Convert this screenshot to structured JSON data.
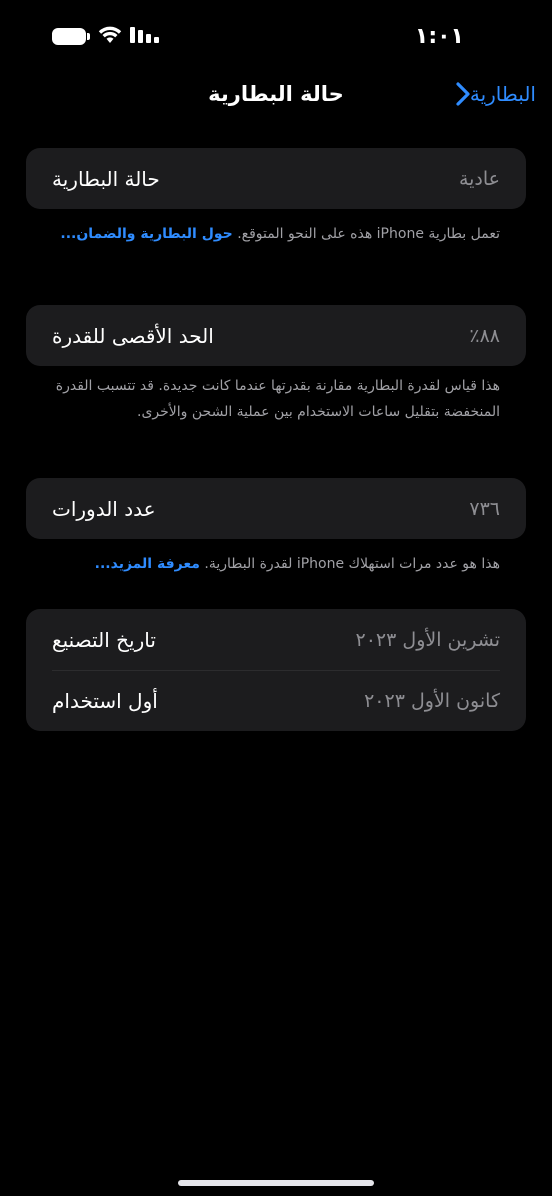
{
  "status_bar": {
    "time": "١:٠١"
  },
  "nav": {
    "back_label": "البطارية",
    "title": "حالة البطارية"
  },
  "battery_health": {
    "label": "حالة البطارية",
    "value": "عادية",
    "footnote": "تعمل بطارية iPhone هذه على النحو المتوقع.",
    "link": "حول البطارية والضمان..."
  },
  "max_capacity": {
    "label": "الحد الأقصى للقدرة",
    "value": "٨٨٪",
    "footnote": "هذا قياس لقدرة البطارية مقارنة بقدرتها عندما كانت جديدة. قد تتسبب القدرة المنخفضة بتقليل ساعات الاستخدام بين عملية الشحن والأخرى."
  },
  "cycle_count": {
    "label": "عدد الدورات",
    "value": "٧٣٦",
    "footnote": "هذا هو عدد مرات استهلاك iPhone لقدرة البطارية.",
    "link": "معرفة المزيد..."
  },
  "dates": {
    "manufacture_label": "تاريخ التصنيع",
    "manufacture_value": "تشرين الأول ٢٠٢٣",
    "first_use_label": "أول استخدام",
    "first_use_value": "كانون الأول ٢٠٢٣"
  },
  "colors": {
    "accent": "#2f8cff",
    "card": "#1c1c1e",
    "background": "#000000"
  }
}
